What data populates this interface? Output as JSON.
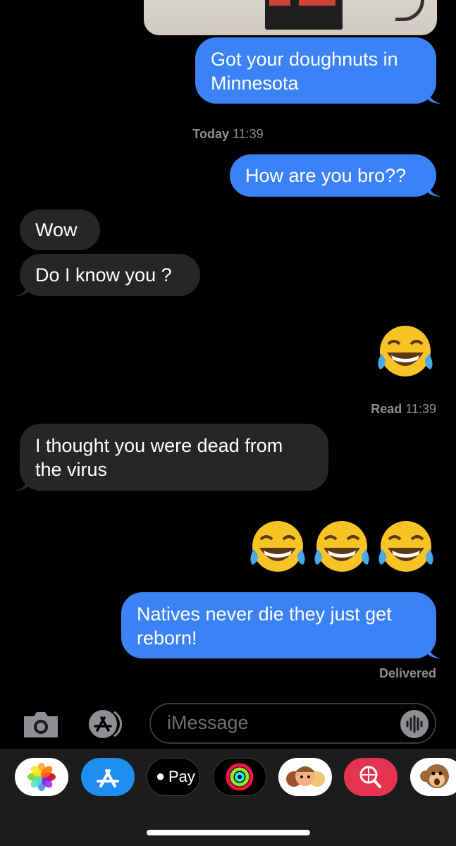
{
  "conversation": {
    "messages": [
      {
        "from": "me",
        "text": "Got your doughnuts in Minnesota"
      },
      {
        "type": "timestamp",
        "label": "Today",
        "time": "11:39"
      },
      {
        "from": "me",
        "text": "How are you bro??"
      },
      {
        "from": "them",
        "text": "Wow"
      },
      {
        "from": "them",
        "text": "Do I know you ?"
      },
      {
        "from": "me",
        "emoji": "face-with-tears-of-joy",
        "count": 1
      },
      {
        "type": "read_receipt",
        "label": "Read",
        "time": "11:39"
      },
      {
        "from": "them",
        "text": "I thought you were dead from the virus"
      },
      {
        "from": "me",
        "emoji": "face-with-tears-of-joy",
        "count": 3
      },
      {
        "from": "me",
        "text": "Natives never die they just get reborn!"
      },
      {
        "type": "status",
        "label": "Delivered"
      }
    ]
  },
  "compose": {
    "placeholder": "iMessage",
    "camera_icon": "camera-icon",
    "appstore_icon": "app-store-icon",
    "audio_icon": "audio-waveform-icon"
  },
  "app_tray": {
    "items": [
      {
        "name": "Photos",
        "icon": "photos-icon"
      },
      {
        "name": "App Store",
        "icon": "app-store-icon"
      },
      {
        "name": "Apple Pay",
        "label": "Pay",
        "icon": "apple-pay-icon"
      },
      {
        "name": "Activity",
        "icon": "activity-rings-icon"
      },
      {
        "name": "Memoji",
        "icon": "memoji-icon"
      },
      {
        "name": "Search",
        "icon": "web-search-icon"
      },
      {
        "name": "Animoji",
        "icon": "monkey-animoji-icon"
      }
    ]
  },
  "colors": {
    "sent_bubble": "#3b82f6",
    "received_bubble": "#262628",
    "background": "#000000",
    "meta_text": "#8e8e93"
  }
}
